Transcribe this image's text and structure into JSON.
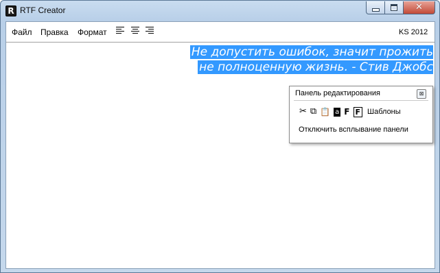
{
  "window": {
    "title": "RTF Creator",
    "icon_letter": "R",
    "close_glyph": "✕"
  },
  "menubar": {
    "items": [
      "Файл",
      "Правка",
      "Формат"
    ],
    "version": "KS 2012",
    "align_icons": [
      "align-left-icon",
      "align-center-icon",
      "align-right-icon"
    ]
  },
  "document": {
    "line1": "Не допустить ошибок, значит прожить",
    "line2": "не полноценную жизнь. - Стив Джобс",
    "selection_color": "#3399ff"
  },
  "edit_panel": {
    "title": "Панель редактирования",
    "tools": {
      "cut": "✂",
      "copy": "⧉",
      "paste": "📋",
      "text_color": "a",
      "font": "F",
      "font_box": "F",
      "templates": "Шаблоны"
    },
    "close_glyph": "⊠",
    "disable_popup_link": "Отключить всплывание панели"
  }
}
